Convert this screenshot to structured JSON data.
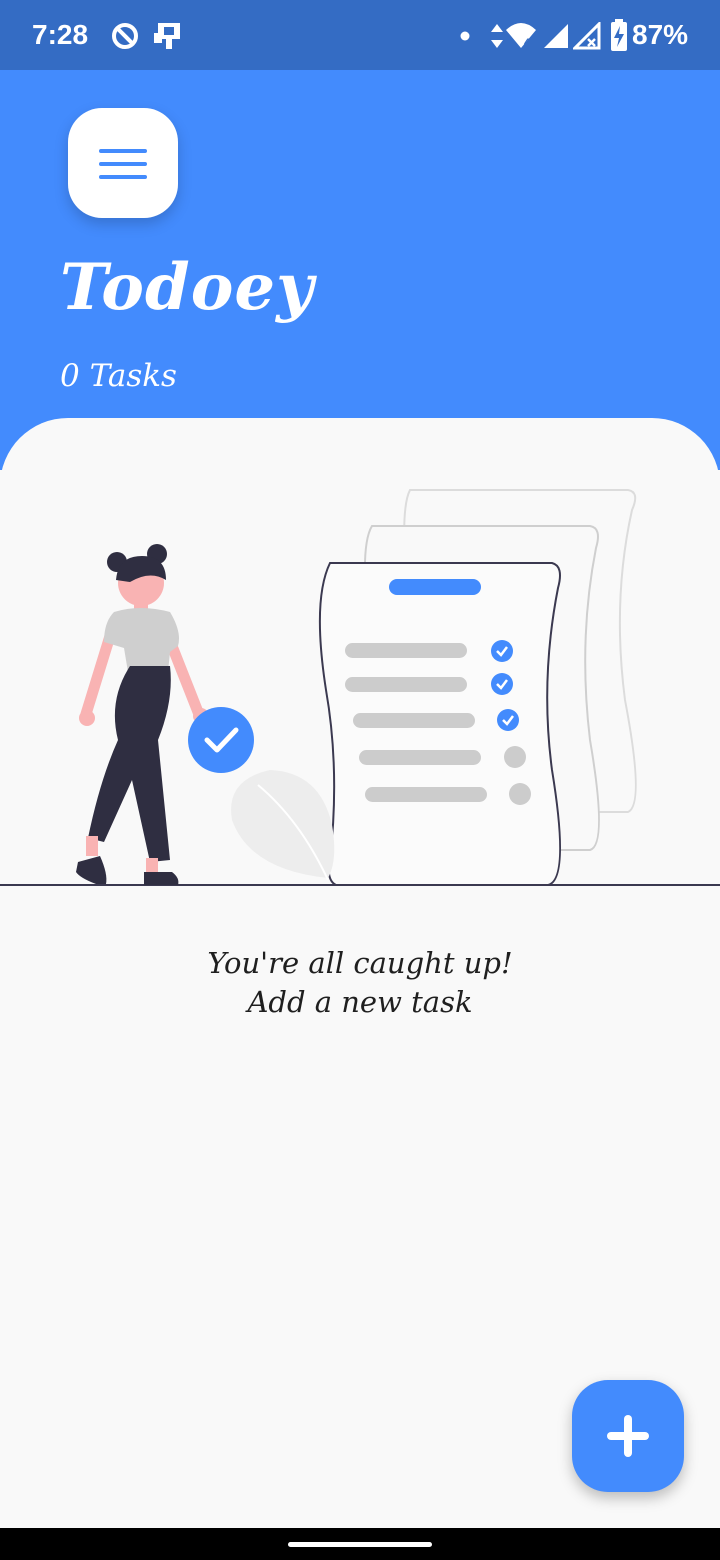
{
  "status_bar": {
    "time": "7:28",
    "battery_percent": "87%",
    "icons": [
      "do-not-disturb-icon",
      "notification-icon",
      "dot-icon",
      "data-arrows-icon",
      "wifi-icon",
      "cell-signal-icon",
      "cell-signal-x-icon",
      "battery-charging-icon"
    ]
  },
  "header": {
    "menu_icon": "hamburger-menu-icon",
    "title": "Todoey",
    "task_count": "0 Tasks",
    "background_color": "#438bfd"
  },
  "empty_state": {
    "illustration": "woman-with-checklist-illustration",
    "line1": "You're all caught up!",
    "line2": "Add a new task"
  },
  "fab": {
    "icon": "plus-icon",
    "color": "#438bfd"
  },
  "colors": {
    "accent": "#438bfd",
    "status_bar": "#346cc4",
    "background": "#f9f9f9"
  }
}
